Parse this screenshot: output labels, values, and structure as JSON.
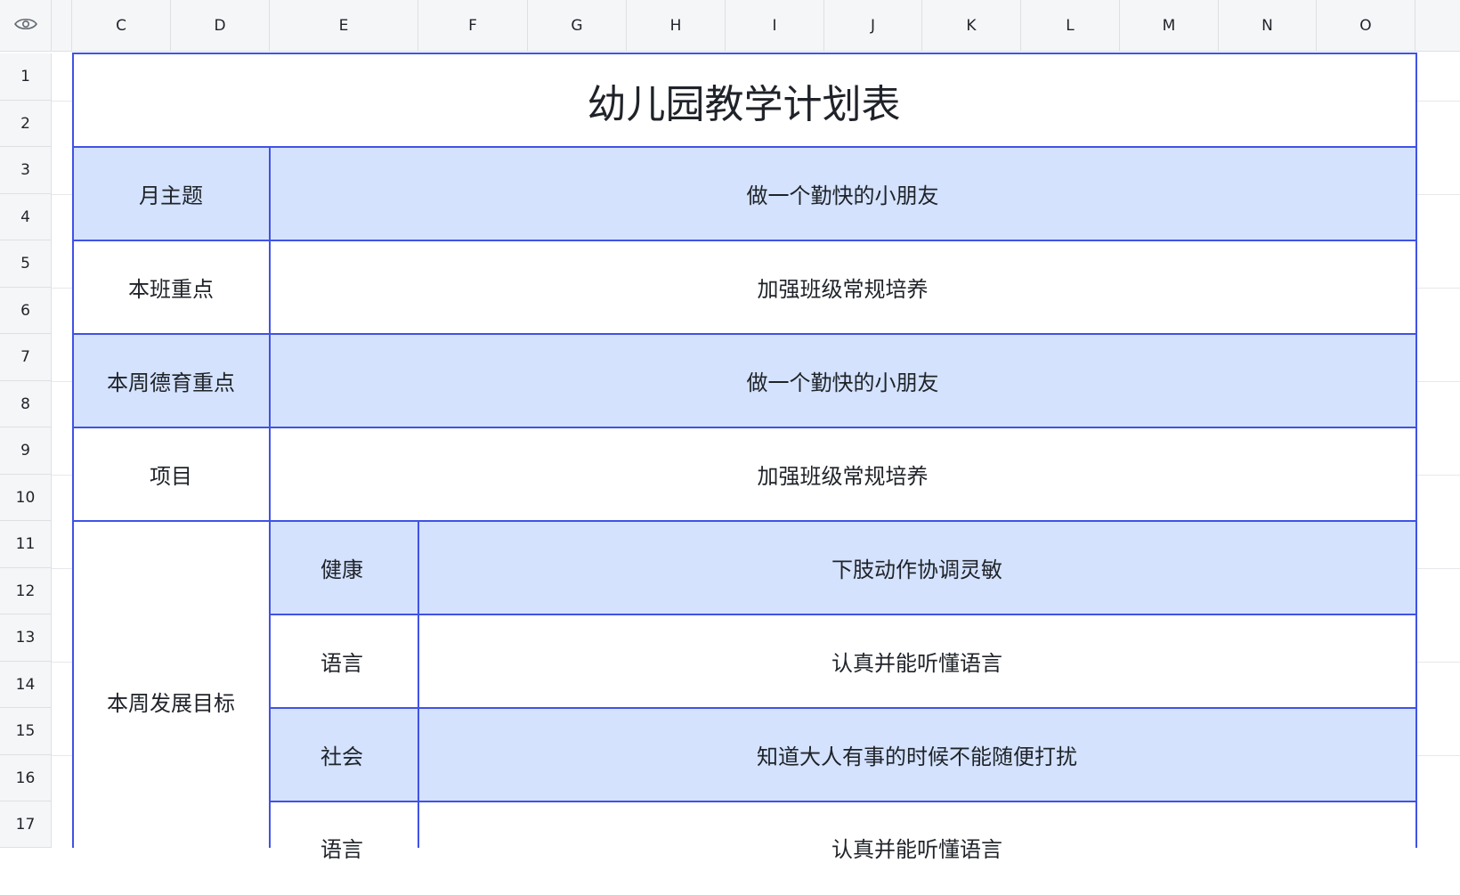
{
  "sheet": {
    "columns": [
      "C",
      "D",
      "E",
      "F",
      "G",
      "H",
      "I",
      "J",
      "K",
      "L",
      "M",
      "N",
      "O"
    ],
    "rows": [
      "1",
      "2",
      "3",
      "4",
      "5",
      "6",
      "7",
      "8",
      "9",
      "10",
      "11",
      "12",
      "13",
      "14",
      "15",
      "16",
      "17"
    ]
  },
  "table": {
    "title": "幼儿园教学计划表",
    "rows": [
      {
        "label": "月主题",
        "value": "做一个勤快的小朋友"
      },
      {
        "label": "本班重点",
        "value": "加强班级常规培养"
      },
      {
        "label": "本周德育重点",
        "value": "做一个勤快的小朋友"
      },
      {
        "label": "项目",
        "value": "加强班级常规培养"
      }
    ],
    "goals_label": "本周发展目标",
    "goals": [
      {
        "area": "健康",
        "text": "下肢动作协调灵敏"
      },
      {
        "area": "语言",
        "text": "认真并能听懂语言"
      },
      {
        "area": "社会",
        "text": "知道大人有事的时候不能随便打扰"
      },
      {
        "area": "语言",
        "text": "认真并能听懂语言"
      }
    ]
  },
  "colors": {
    "border": "#4052e6",
    "band": "#d4e2fd",
    "header_bg": "#f5f6f7"
  },
  "icons": {
    "corner": "eye-icon"
  }
}
